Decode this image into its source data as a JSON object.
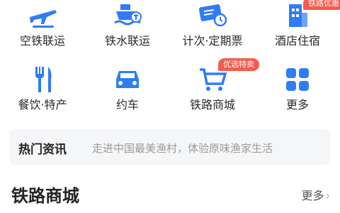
{
  "services": [
    {
      "label": "空铁联运",
      "icon": "plane-train-icon"
    },
    {
      "label": "铁水联运",
      "icon": "ship-rail-icon"
    },
    {
      "label": "计次·定期票",
      "icon": "ticket-clock-icon"
    },
    {
      "label": "酒店住宿",
      "icon": "hotel-icon",
      "badge": "铁路优惠"
    },
    {
      "label": "餐饮·特产",
      "icon": "fork-knife-icon"
    },
    {
      "label": "约车",
      "icon": "car-icon"
    },
    {
      "label": "铁路商城",
      "icon": "shopping-cart-icon",
      "badge": "优选特卖"
    },
    {
      "label": "更多",
      "icon": "grid-more-icon"
    }
  ],
  "news": {
    "tag": "热门资讯",
    "text": "走进中国最美渔村，体验原味渔家生活"
  },
  "section": {
    "title": "铁路商城",
    "more": "更多"
  },
  "colors": {
    "accent": "#2f7cf6",
    "badge": "#f45b4e",
    "news_bg": "#f5f6f8"
  }
}
